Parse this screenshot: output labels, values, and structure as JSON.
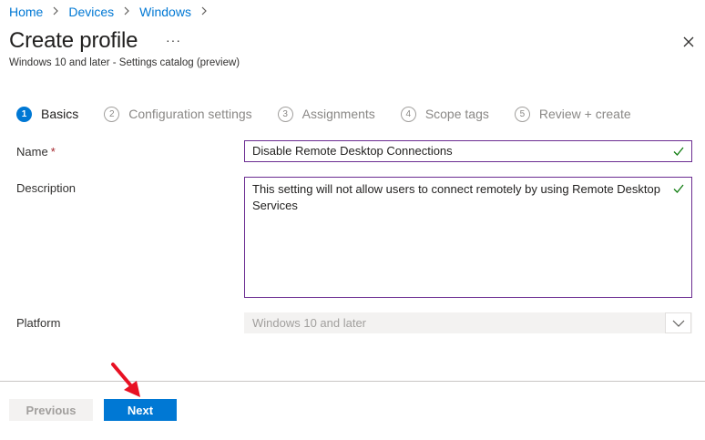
{
  "breadcrumb": [
    "Home",
    "Devices",
    "Windows"
  ],
  "page": {
    "title": "Create profile",
    "more": "···",
    "subtitle": "Windows 10 and later - Settings catalog (preview)"
  },
  "steps": [
    {
      "num": "1",
      "label": "Basics",
      "active": true
    },
    {
      "num": "2",
      "label": "Configuration settings",
      "active": false
    },
    {
      "num": "3",
      "label": "Assignments",
      "active": false
    },
    {
      "num": "4",
      "label": "Scope tags",
      "active": false
    },
    {
      "num": "5",
      "label": "Review + create",
      "active": false
    }
  ],
  "form": {
    "name_label": "Name",
    "required_mark": "*",
    "name_value": "Disable Remote Desktop Connections",
    "description_label": "Description",
    "description_value": "This setting will not allow users to connect remotely by using Remote Desktop Services",
    "platform_label": "Platform",
    "platform_value": "Windows 10 and later"
  },
  "footer": {
    "previous_label": "Previous",
    "next_label": "Next"
  },
  "colors": {
    "accent": "#0078d4",
    "field_border": "#6b2c91",
    "valid_check": "#107c10",
    "annotation_arrow": "#e81123"
  }
}
